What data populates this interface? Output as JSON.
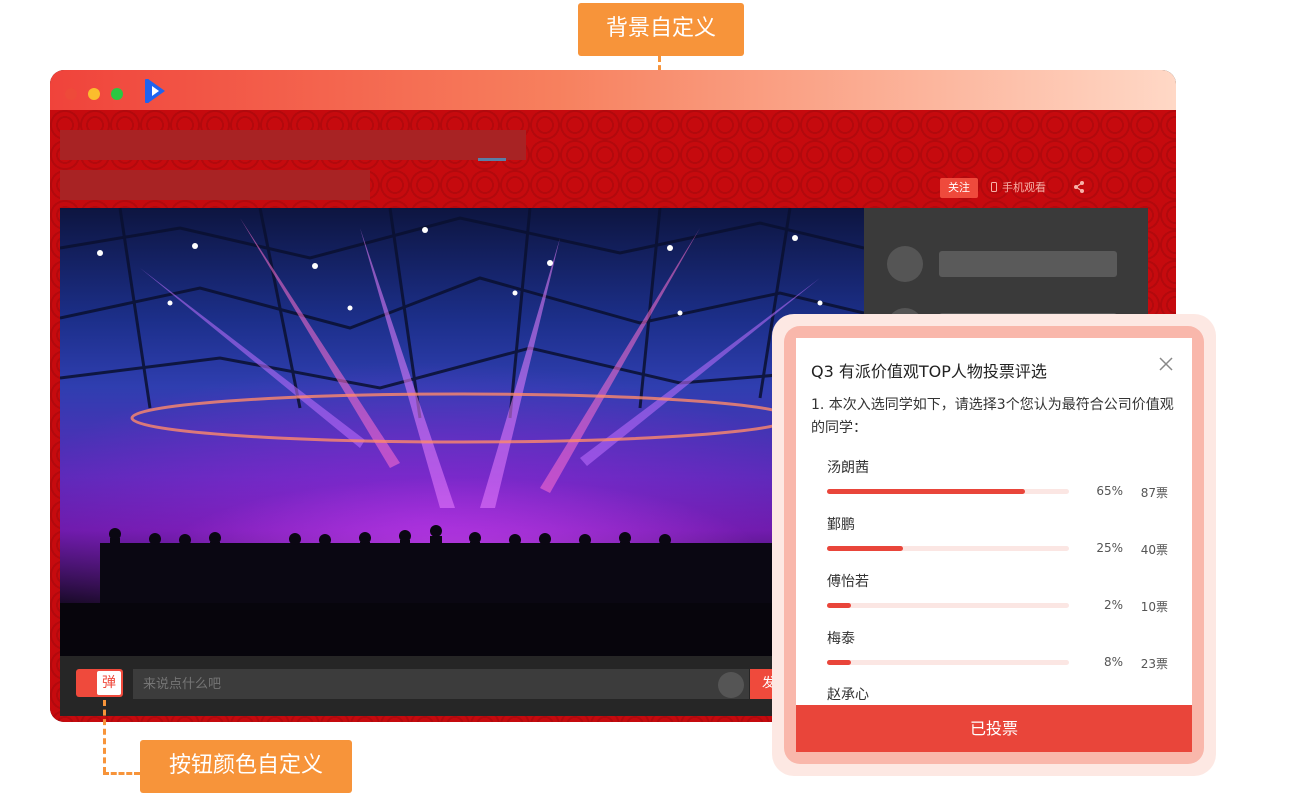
{
  "callouts": {
    "background": "背景自定义",
    "button_color": "按钮颜色自定义"
  },
  "colors": {
    "accent": "#ef4a3c",
    "callout": "#f7943a",
    "background_red": "#c60a0e"
  },
  "header": {
    "follow_label": "关注",
    "mobile_watch_label": "手机观看",
    "share_icon": "share-icon"
  },
  "chat": {
    "danmu_label": "弹",
    "placeholder": "来说点什么吧",
    "send_label": "发送"
  },
  "vote": {
    "title": "Q3 有派价值观TOP人物投票评选",
    "question": "1. 本次入选同学如下，请选择3个您认为最符合公司价值观的同学：",
    "candidates": [
      {
        "name": "汤朗茜",
        "percent_label": "65%",
        "percent": 65,
        "votes_label": "87票"
      },
      {
        "name": "鄞鹏",
        "percent_label": "25%",
        "percent": 25,
        "votes_label": "40票"
      },
      {
        "name": "傅怡若",
        "percent_label": "2%",
        "percent": 2,
        "votes_label": "10票"
      },
      {
        "name": "梅泰",
        "percent_label": "8%",
        "percent": 8,
        "votes_label": "23票"
      },
      {
        "name": "赵承心"
      }
    ],
    "submit_label": "已投票"
  }
}
